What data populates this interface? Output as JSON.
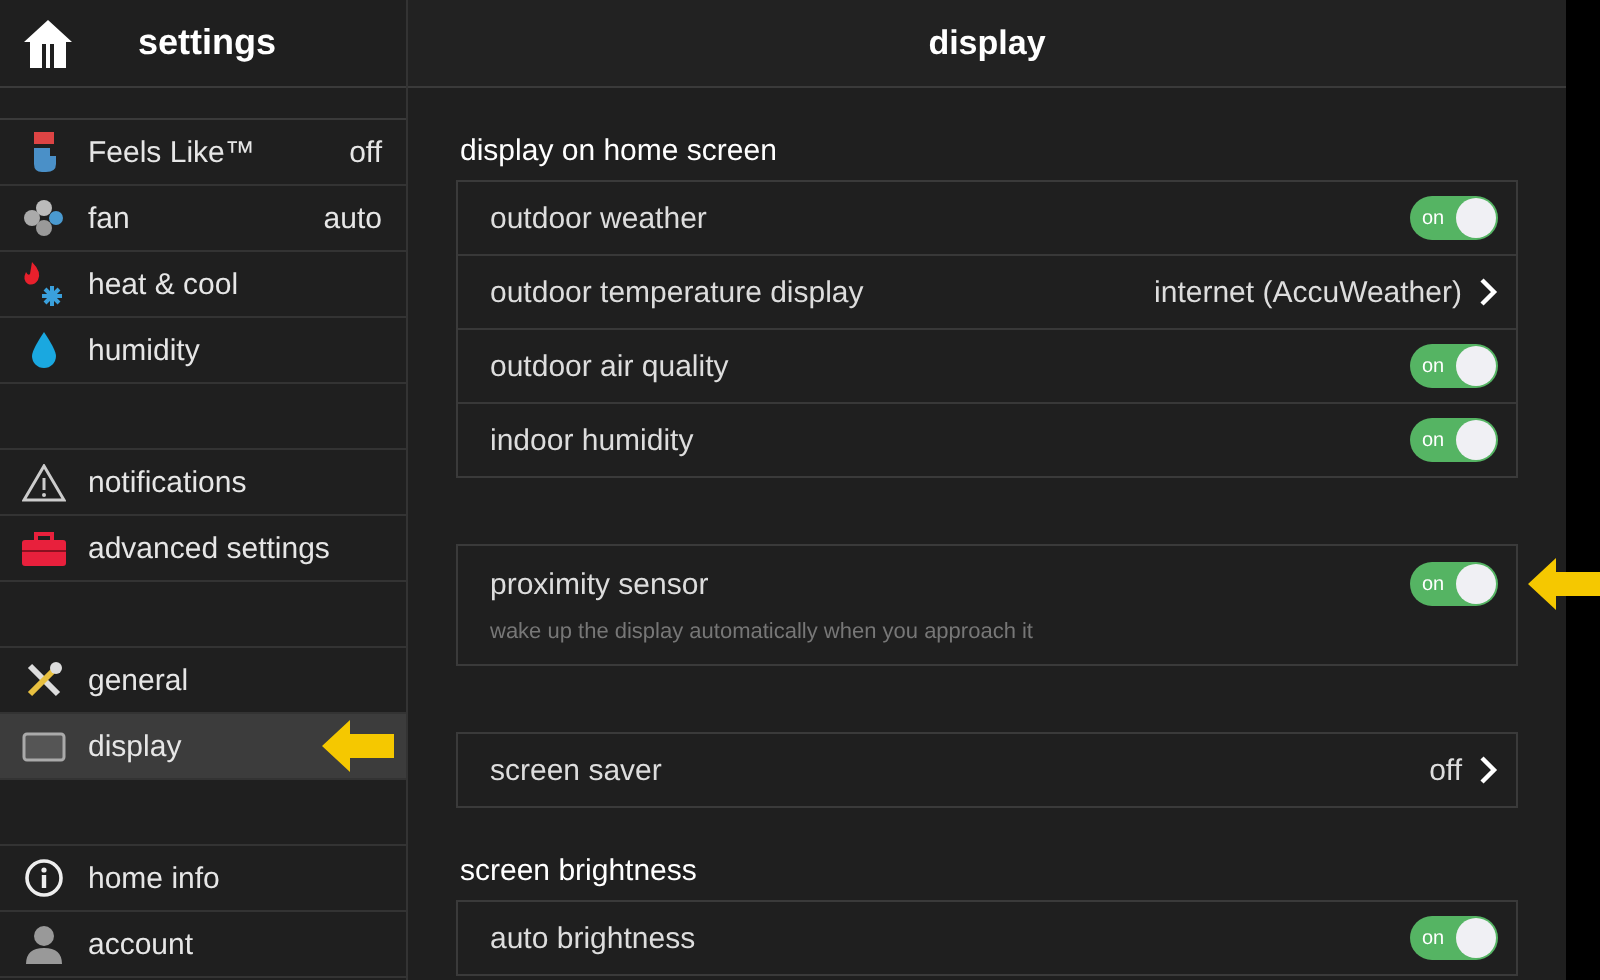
{
  "sidebar": {
    "title": "settings",
    "groups": [
      [
        {
          "label": "Feels Like™",
          "value": "off",
          "selected": false,
          "pointer_arrow": false
        },
        {
          "label": "fan",
          "value": "auto",
          "selected": false,
          "pointer_arrow": false
        },
        {
          "label": "heat & cool",
          "selected": false,
          "pointer_arrow": false
        },
        {
          "label": "humidity",
          "selected": false,
          "pointer_arrow": false
        }
      ],
      [
        {
          "label": "notifications",
          "selected": false,
          "pointer_arrow": false
        },
        {
          "label": "advanced settings",
          "selected": false,
          "pointer_arrow": false
        }
      ],
      [
        {
          "label": "general",
          "selected": false,
          "pointer_arrow": false
        },
        {
          "label": "display",
          "selected": true,
          "pointer_arrow": true
        }
      ],
      [
        {
          "label": "home info",
          "selected": false,
          "pointer_arrow": false
        },
        {
          "label": "account",
          "selected": false,
          "pointer_arrow": false
        }
      ]
    ]
  },
  "main": {
    "title": "display",
    "sections": [
      {
        "heading": "display on home screen",
        "rows": [
          {
            "kind": "toggle",
            "label": "outdoor weather",
            "on": true,
            "switch_text": "on",
            "pointer_arrow": false
          },
          {
            "kind": "link",
            "label": "outdoor temperature display",
            "value": "internet (AccuWeather)",
            "pointer_arrow": false
          },
          {
            "kind": "toggle",
            "label": "outdoor air quality",
            "on": true,
            "switch_text": "on",
            "pointer_arrow": false
          },
          {
            "kind": "toggle",
            "label": "indoor humidity",
            "on": true,
            "switch_text": "on",
            "pointer_arrow": false
          }
        ]
      },
      {
        "rows": [
          {
            "kind": "toggle",
            "label": "proximity sensor",
            "description": "wake up the display automatically when you approach it",
            "on": true,
            "switch_text": "on",
            "pointer_arrow": true
          }
        ]
      },
      {
        "rows": [
          {
            "kind": "link",
            "label": "screen saver",
            "value": "off",
            "pointer_arrow": false
          }
        ]
      },
      {
        "heading": "screen brightness",
        "rows": [
          {
            "kind": "toggle",
            "label": "auto brightness",
            "on": true,
            "switch_text": "on",
            "pointer_arrow": false
          }
        ]
      }
    ]
  }
}
